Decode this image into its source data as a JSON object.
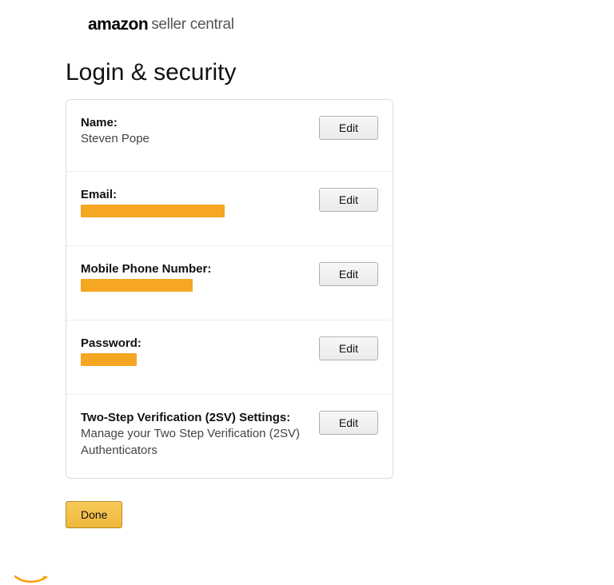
{
  "brand": {
    "name": "amazon",
    "product": "seller central"
  },
  "page": {
    "title": "Login & security"
  },
  "rows": {
    "name": {
      "label": "Name:",
      "value": "Steven Pope",
      "edit": "Edit"
    },
    "email": {
      "label": "Email:",
      "edit": "Edit"
    },
    "phone": {
      "label": "Mobile Phone Number:",
      "edit": "Edit"
    },
    "pwd": {
      "label": "Password:",
      "edit": "Edit"
    },
    "twosv": {
      "label": "Two-Step Verification (2SV) Settings:",
      "desc": "Manage your Two Step Verification (2SV) Authenticators",
      "edit": "Edit"
    }
  },
  "actions": {
    "done": "Done"
  }
}
